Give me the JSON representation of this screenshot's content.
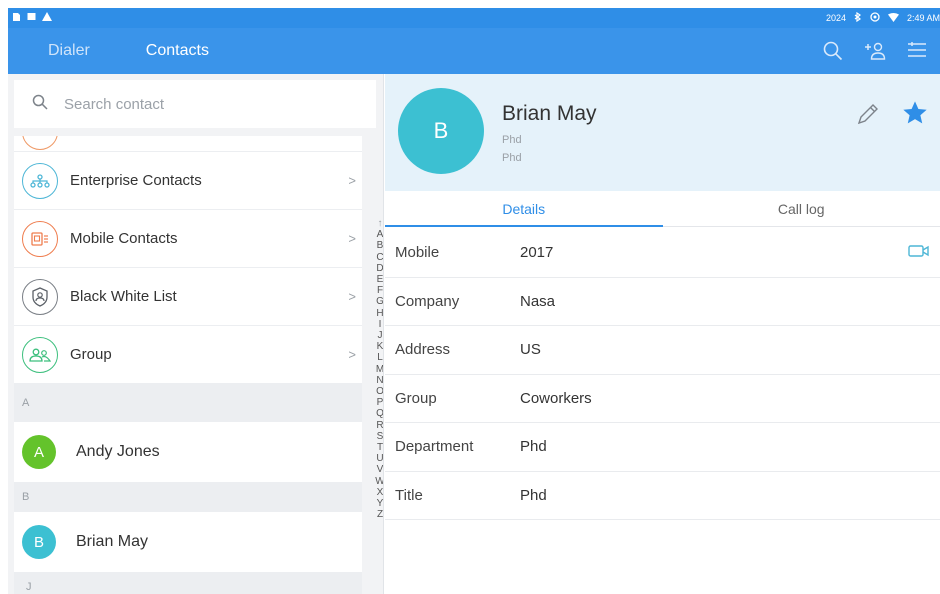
{
  "statusbar": {
    "left_icons": [
      "sim-icon",
      "message-icon",
      "alert-icon"
    ],
    "year": "2024",
    "time": "2:49 AM"
  },
  "appbar": {
    "tabs": [
      {
        "label": "Dialer",
        "active": false
      },
      {
        "label": "Contacts",
        "active": true
      }
    ],
    "actions": [
      "search-icon",
      "add-contact-icon",
      "menu-icon"
    ],
    "color": "#3a94ea"
  },
  "search": {
    "placeholder": "Search contact"
  },
  "categories": [
    {
      "label": "Enterprise Contacts",
      "icon": "org-chart-icon",
      "color": "#4db6d6"
    },
    {
      "label": "Mobile Contacts",
      "icon": "mobile-contacts-icon",
      "color": "#ef7d4e"
    },
    {
      "label": "Black White List",
      "icon": "shield-user-icon",
      "color": "#7a7f86"
    },
    {
      "label": "Group",
      "icon": "group-icon",
      "color": "#3cbf7d"
    }
  ],
  "contacts": {
    "sections": [
      {
        "letter": "A",
        "items": [
          {
            "initial": "A",
            "name": "Andy Jones",
            "color": "#64c32b"
          }
        ]
      },
      {
        "letter": "B",
        "items": [
          {
            "initial": "B",
            "name": "Brian May",
            "color": "#3cc0d2"
          }
        ]
      }
    ],
    "tail_letter": "J"
  },
  "alphabet": [
    "↑",
    "A",
    "B",
    "C",
    "D",
    "E",
    "F",
    "G",
    "H",
    "I",
    "J",
    "K",
    "L",
    "M",
    "N",
    "O",
    "P",
    "Q",
    "R",
    "S",
    "T",
    "U",
    "V",
    "W",
    "X",
    "Y",
    "Z"
  ],
  "detail": {
    "initial": "B",
    "name": "Brian May",
    "sub1": "Phd",
    "sub2": "Phd",
    "tabs": [
      {
        "label": "Details",
        "active": true
      },
      {
        "label": "Call log",
        "active": false
      }
    ],
    "fields": [
      {
        "key": "Mobile",
        "value": "2017"
      },
      {
        "key": "Company",
        "value": "Nasa"
      },
      {
        "key": "Address",
        "value": "US"
      },
      {
        "key": "Group",
        "value": "Coworkers"
      },
      {
        "key": "Department",
        "value": "Phd"
      },
      {
        "key": "Title",
        "value": "Phd"
      }
    ],
    "accent": "#2f8ee7"
  }
}
